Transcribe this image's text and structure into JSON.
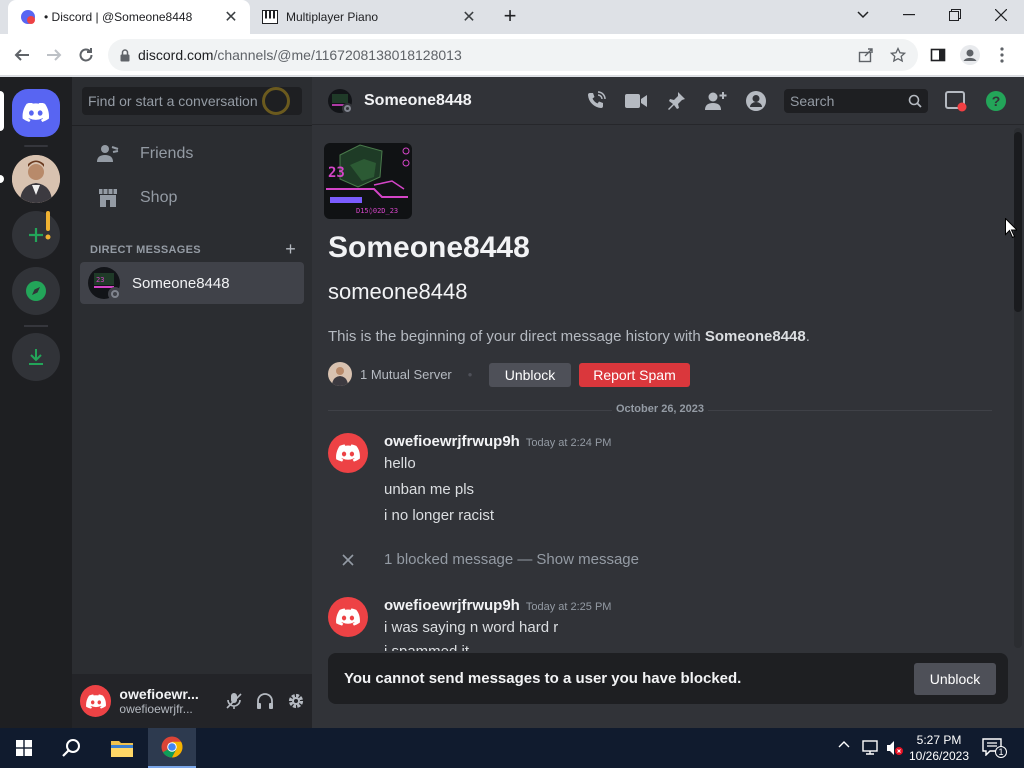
{
  "browser": {
    "tabs": [
      {
        "title": "• Discord | @Someone8448",
        "active": true
      },
      {
        "title": "Multiplayer Piano",
        "active": false
      }
    ],
    "new_tab_label": "+",
    "url_domain": "discord.com",
    "url_path": "/channels/@me/1167208138018128013"
  },
  "discord": {
    "search_placeholder": "Find or start a conversation",
    "nav": [
      {
        "label": "Friends",
        "icon": "friends-icon"
      },
      {
        "label": "Shop",
        "icon": "shop-icon"
      }
    ],
    "dm_header": "DIRECT MESSAGES",
    "dm_add": "+",
    "dm_items": [
      {
        "name": "Someone8448"
      }
    ],
    "user_panel": {
      "display_name": "owefioewr...",
      "username": "owefioewrjfr..."
    },
    "chat_header": {
      "name": "Someone8448",
      "search_placeholder": "Search"
    },
    "intro": {
      "display_name": "Someone8448",
      "username": "someone8448",
      "description_prefix": "This is the beginning of your direct message history with ",
      "description_name": "Someone8448",
      "description_suffix": ".",
      "mutual": "1 Mutual Server",
      "separator": "•",
      "unblock_label": "Unblock",
      "report_label": "Report Spam"
    },
    "date_divider": "October 26, 2023",
    "messages": [
      {
        "author": "owefioewrjfrwup9h",
        "timestamp": "Today at 2:24 PM",
        "lines": [
          "hello",
          "unban me pls",
          "i no longer racist"
        ]
      },
      {
        "author": "owefioewrjfrwup9h",
        "timestamp": "Today at 2:25 PM",
        "lines": [
          "i was saying n word hard r",
          "i spammed it"
        ]
      }
    ],
    "blocked_message": {
      "text": "1 blocked message — ",
      "action": "Show message"
    },
    "block_notice": {
      "text": "You cannot send messages to a user you have blocked.",
      "button": "Unblock"
    }
  },
  "taskbar": {
    "time": "5:27 PM",
    "date": "10/26/2023",
    "notification_count": "1"
  },
  "colors": {
    "blurple": "#5865f2",
    "red": "#da373c",
    "green": "#23a559",
    "bg_chat": "#313338",
    "bg_sidebar": "#2b2d31",
    "bg_guilds": "#1e1f22"
  }
}
